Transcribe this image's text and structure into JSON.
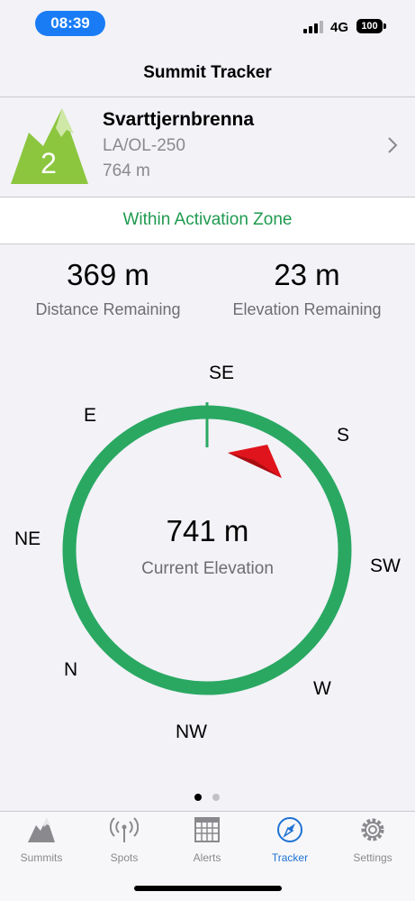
{
  "status": {
    "time": "08:39",
    "network": "4G",
    "battery": "100"
  },
  "nav": {
    "title": "Summit Tracker"
  },
  "summit": {
    "points": "2",
    "name": "Svarttjernbrenna",
    "reference": "LA/OL-250",
    "altitude": "764 m"
  },
  "zone": {
    "text": "Within Activation Zone",
    "color": "#1f9a4f"
  },
  "stats": {
    "distance_value": "369 m",
    "distance_label": "Distance Remaining",
    "elevation_value": "23 m",
    "elevation_label": "Elevation Remaining"
  },
  "compass": {
    "labels": {
      "se": "SE",
      "s": "S",
      "sw": "SW",
      "w": "W",
      "nw": "NW",
      "n": "N",
      "ne": "NE",
      "e": "E"
    },
    "current_elevation": "741 m",
    "current_elevation_label": "Current Elevation",
    "ring_color": "#2aa862",
    "pointer_color": "#e0141c"
  },
  "pager": {
    "pages": 2,
    "current": 1
  },
  "tabs": [
    {
      "label": "Summits",
      "icon": "mountain-icon"
    },
    {
      "label": "Spots",
      "icon": "antenna-icon"
    },
    {
      "label": "Alerts",
      "icon": "calendar-icon"
    },
    {
      "label": "Tracker",
      "icon": "compass-icon",
      "active": true
    },
    {
      "label": "Settings",
      "icon": "gear-icon"
    }
  ]
}
